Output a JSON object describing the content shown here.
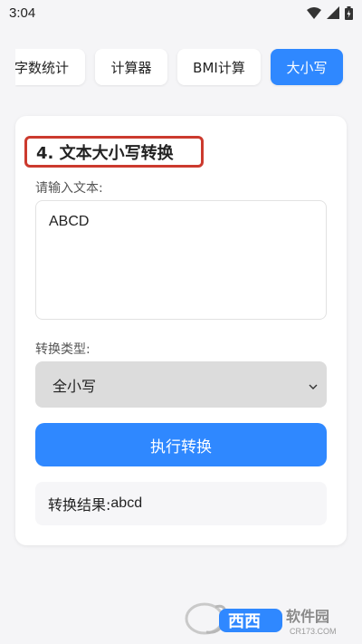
{
  "status_bar": {
    "time": "3:04",
    "icons": [
      "wifi-icon",
      "signal-icon",
      "battery-icon"
    ]
  },
  "tabs": [
    {
      "label": "字数统计",
      "active": false
    },
    {
      "label": "计算器",
      "active": false
    },
    {
      "label": "BMI计算",
      "active": false
    },
    {
      "label": "大小写",
      "active": true
    }
  ],
  "section": {
    "title": "4. 文本大小写转换"
  },
  "input": {
    "label": "请输入文本:",
    "value": "ABCD"
  },
  "conversion": {
    "label": "转换类型:",
    "selected": "全小写"
  },
  "action": {
    "label": "执行转换"
  },
  "result": {
    "prefix": "转换结果:",
    "value": "abcd"
  },
  "watermark": {
    "text": "西西软件园",
    "sub": "CR173.COM"
  },
  "colors": {
    "accent": "#2f88ff",
    "highlight_border": "#cc3a2e",
    "background": "#f5f5f7"
  }
}
